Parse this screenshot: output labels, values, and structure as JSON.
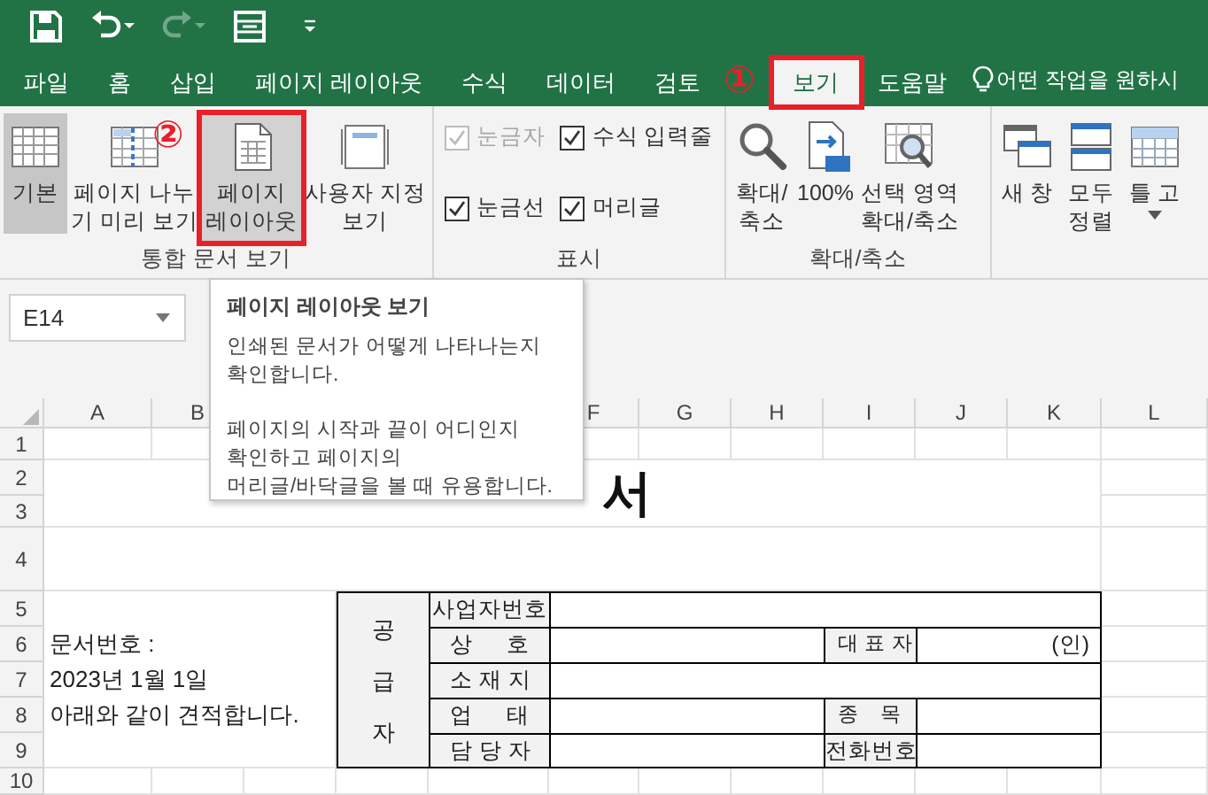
{
  "tabs": [
    {
      "label": "파일",
      "selected": false
    },
    {
      "label": "홈",
      "selected": false
    },
    {
      "label": "삽입",
      "selected": false
    },
    {
      "label": "페이지 레이아웃",
      "selected": false
    },
    {
      "label": "수식",
      "selected": false
    },
    {
      "label": "데이터",
      "selected": false
    },
    {
      "label": "검토",
      "selected": false
    },
    {
      "label": "보기",
      "selected": true,
      "annotation": "①"
    },
    {
      "label": "도움말",
      "selected": false
    }
  ],
  "tell_me": {
    "placeholder": "어떤 작업을 원하시"
  },
  "ribbon": {
    "groups": [
      {
        "label": "통합 문서 보기",
        "buttons": [
          {
            "kind": "normal",
            "lines": [
              "기본"
            ],
            "selected": true,
            "hovered": false
          },
          {
            "kind": "pagebreak",
            "lines": [
              "페이지 나누",
              "기 미리 보기"
            ],
            "selected": false,
            "hovered": false
          },
          {
            "kind": "pagelayout",
            "lines": [
              "페이지",
              "레이아웃"
            ],
            "selected": false,
            "hovered": true,
            "annotation": "②"
          },
          {
            "kind": "custom",
            "lines": [
              "사용자 지정",
              "보기"
            ],
            "selected": false,
            "hovered": false
          }
        ]
      },
      {
        "label": "표시",
        "checkboxes": [
          {
            "label": "눈금자",
            "checked": true,
            "disabled": true
          },
          {
            "label": "수식 입력줄",
            "checked": true,
            "disabled": false
          },
          {
            "label": "눈금선",
            "checked": true,
            "disabled": false
          },
          {
            "label": "머리글",
            "checked": true,
            "disabled": false
          }
        ]
      },
      {
        "label": "확대/축소",
        "buttons": [
          {
            "kind": "zoom",
            "lines": [
              "확대/",
              "축소"
            ]
          },
          {
            "kind": "zoom100",
            "lines": [
              "100%"
            ]
          },
          {
            "kind": "zoomsel",
            "lines": [
              "선택 영역",
              "확대/축소"
            ]
          }
        ]
      },
      {
        "buttons": [
          {
            "kind": "newwindow",
            "lines": [
              "새 창"
            ]
          },
          {
            "kind": "arrange",
            "lines": [
              "모두",
              "정렬"
            ]
          },
          {
            "kind": "freeze",
            "lines": [
              "틀 고"
            ],
            "dropdown": true
          }
        ]
      }
    ]
  },
  "name_box": {
    "value": "E14"
  },
  "tooltip": {
    "title": "페이지 레이아웃 보기",
    "paragraphs": [
      {
        "lines": [
          "인쇄된 문서가 어떻게 나타나는지",
          "확인합니다."
        ]
      },
      {
        "lines": [
          "페이지의 시작과 끝이 어디인지",
          "확인하고 페이지의",
          "머리글/바닥글을 볼 때 유용합니다."
        ]
      }
    ]
  },
  "sheet": {
    "column_headers": [
      "A",
      "B",
      "F",
      "G",
      "H",
      "I",
      "J",
      "K",
      "L"
    ],
    "row_headers": [
      "1",
      "2",
      "3",
      "4",
      "5",
      "6",
      "7",
      "8",
      "9",
      "10"
    ],
    "title": "서",
    "notes": [
      "문서번호 :",
      "2023년 1월 1일",
      "아래와 같이 견적합니다."
    ],
    "supplier_table": {
      "side_label": "공급자",
      "rows": [
        {
          "cells": [
            {
              "kind": "label",
              "text": "사업자번호",
              "spread": false
            },
            {
              "kind": "value"
            }
          ]
        },
        {
          "cells": [
            {
              "kind": "label",
              "text": "상 호",
              "spread": true
            },
            {
              "kind": "value"
            },
            {
              "kind": "label",
              "text": "대 표 자",
              "spread": true
            },
            {
              "kind": "value",
              "text": "(인)"
            }
          ]
        },
        {
          "cells": [
            {
              "kind": "label",
              "text": "소 재 지",
              "spread": true
            },
            {
              "kind": "value"
            }
          ]
        },
        {
          "cells": [
            {
              "kind": "label",
              "text": "업 태",
              "spread": true
            },
            {
              "kind": "value"
            },
            {
              "kind": "label",
              "text": "종 목",
              "spread": true
            },
            {
              "kind": "value"
            }
          ]
        },
        {
          "cells": [
            {
              "kind": "label",
              "text": "담 당 자",
              "spread": true
            },
            {
              "kind": "value"
            },
            {
              "kind": "label",
              "text": "전화번호",
              "spread": false
            },
            {
              "kind": "value"
            }
          ]
        }
      ]
    }
  }
}
